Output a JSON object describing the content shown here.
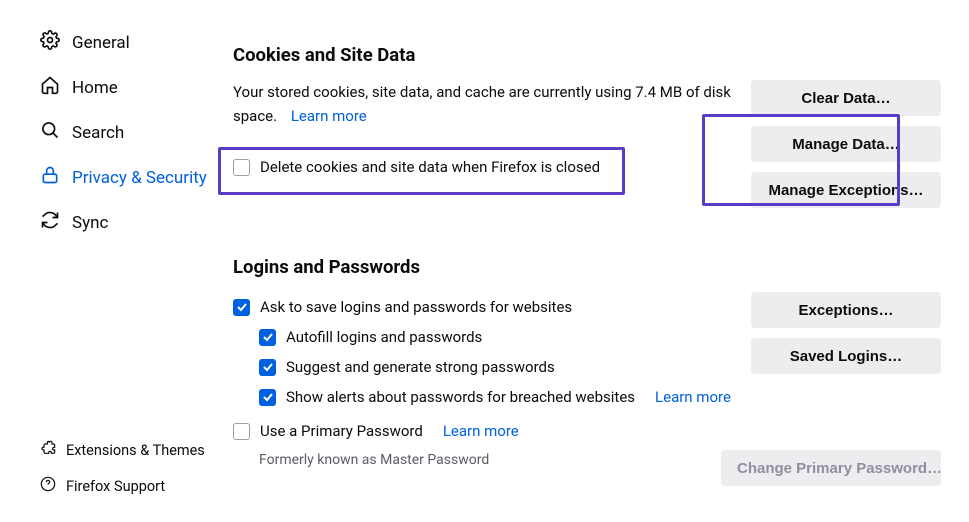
{
  "sidebar": {
    "items": [
      {
        "label": "General"
      },
      {
        "label": "Home"
      },
      {
        "label": "Search"
      },
      {
        "label": "Privacy & Security"
      },
      {
        "label": "Sync"
      }
    ],
    "footer": [
      {
        "label": "Extensions & Themes"
      },
      {
        "label": "Firefox Support"
      }
    ]
  },
  "cookies": {
    "title": "Cookies and Site Data",
    "desc": "Your stored cookies, site data, and cache are currently using 7.4 MB of disk space.",
    "learn_more": "Learn more",
    "delete_label": "Delete cookies and site data when Firefox is closed",
    "buttons": {
      "clear": "Clear Data…",
      "manage_data": "Manage Data…",
      "manage_exceptions": "Manage Exceptions…"
    }
  },
  "logins": {
    "title": "Logins and Passwords",
    "ask_save": "Ask to save logins and passwords for websites",
    "autofill": "Autofill logins and passwords",
    "suggest": "Suggest and generate strong passwords",
    "alerts": "Show alerts about passwords for breached websites",
    "alerts_learn": "Learn more",
    "primary": "Use a Primary Password",
    "primary_learn": "Learn more",
    "primary_note": "Formerly known as Master Password",
    "buttons": {
      "exceptions": "Exceptions…",
      "saved": "Saved Logins…",
      "change_primary": "Change Primary Password…"
    }
  }
}
